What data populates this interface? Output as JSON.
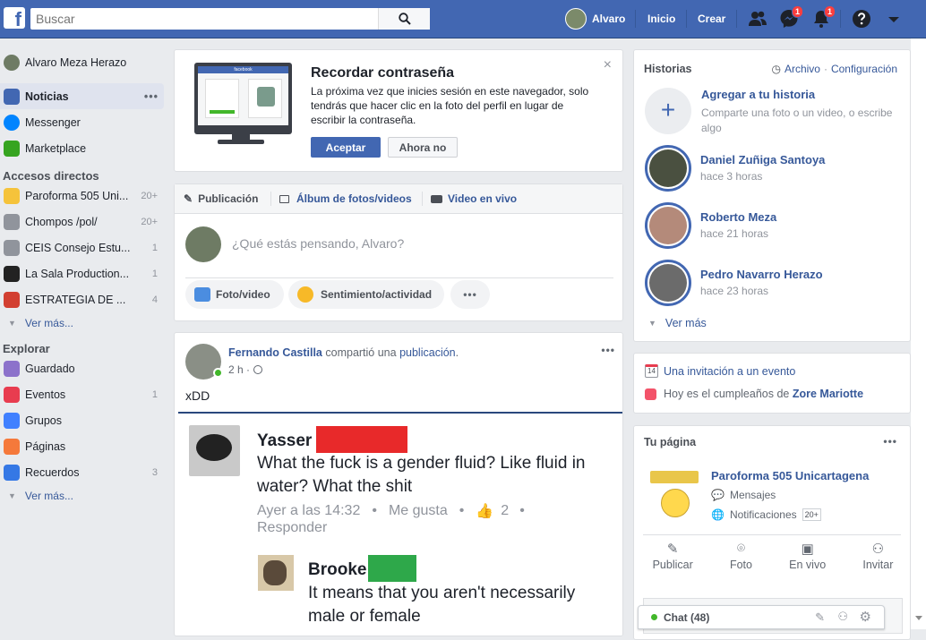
{
  "topbar": {
    "logo": "f",
    "search_placeholder": "Buscar",
    "user_name": "Alvaro",
    "home": "Inicio",
    "create": "Crear",
    "messenger_badge": "1",
    "notifications_badge": "1"
  },
  "left": {
    "profile_name": "Alvaro Meza Herazo",
    "news": "Noticias",
    "messenger": "Messenger",
    "marketplace": "Marketplace",
    "shortcuts_title": "Accesos directos",
    "shortcuts": [
      {
        "label": "Paroforma 505 Uni...",
        "count": "20+",
        "color": "#f5c33b"
      },
      {
        "label": "Chompos /pol/",
        "count": "20+",
        "color": "#90949c"
      },
      {
        "label": "CEIS Consejo Estu...",
        "count": "1",
        "color": "#90949c"
      },
      {
        "label": "La Sala Production...",
        "count": "1",
        "color": "#222222"
      },
      {
        "label": "ESTRATEGIA DE ...",
        "count": "4",
        "color": "#d23f31"
      }
    ],
    "see_more": "Ver más...",
    "explore_title": "Explorar",
    "explore": [
      {
        "label": "Guardado",
        "count": "",
        "color": "#8c72cb"
      },
      {
        "label": "Eventos",
        "count": "1",
        "color": "#e83c4f"
      },
      {
        "label": "Grupos",
        "count": "",
        "color": "#4080ff"
      },
      {
        "label": "Páginas",
        "count": "",
        "color": "#f5793b"
      },
      {
        "label": "Recuerdos",
        "count": "3",
        "color": "#3578e5"
      }
    ]
  },
  "password": {
    "title": "Recordar contraseña",
    "text": "La próxima vez que inicies sesión en este navegador, solo tendrás que hacer clic en la foto del perfil en lugar de escribir la contraseña.",
    "accept": "Aceptar",
    "decline": "Ahora no",
    "screen_title": "facebook"
  },
  "composer": {
    "tab_post": "Publicación",
    "tab_album": "Álbum de fotos/videos",
    "tab_live": "Video en vivo",
    "placeholder": "¿Qué estás pensando, Alvaro?",
    "photo": "Foto/video",
    "feeling": "Sentimiento/actividad"
  },
  "post": {
    "author": "Fernando Castilla",
    "shared": "compartió una",
    "link": "publicación",
    "dot": ".",
    "time": "2 h ·",
    "text": "xDD",
    "c1_name": "Yasser",
    "c1_text": "What the fuck is a gender fluid? Like fluid in water? What the shit",
    "c1_time": "Ayer a las 14:32",
    "c1_like": "Me gusta",
    "c1_count": "2",
    "c1_reply": "Responder",
    "c2_name": "Brooke",
    "c2_text": "It means that you aren't necessarily male or female"
  },
  "stories": {
    "title": "Historias",
    "archive": "Archivo",
    "sep": "·",
    "settings": "Configuración",
    "add_title": "Agregar a tu historia",
    "add_sub": "Comparte una foto o un video, o escribe algo",
    "items": [
      {
        "name": "Daniel Zuñiga Santoya",
        "time": "hace 3 horas"
      },
      {
        "name": "Roberto Meza",
        "time": "hace 21 horas"
      },
      {
        "name": "Pedro Navarro Herazo",
        "time": "hace 23 horas"
      }
    ],
    "see_more": "Ver más"
  },
  "events": {
    "invite": "Una invitación a un evento",
    "bday_pre": "Hoy es el cumpleaños de",
    "bday_name": "Zore Mariotte"
  },
  "page": {
    "title": "Tu página",
    "name": "Paroforma 505 Unicartagena",
    "messages": "Mensajes",
    "notifications": "Notificaciones",
    "notif_count": "20+",
    "actions": [
      "Publicar",
      "Foto",
      "En vivo",
      "Invitar"
    ]
  },
  "chat": {
    "label": "Chat (48)"
  }
}
